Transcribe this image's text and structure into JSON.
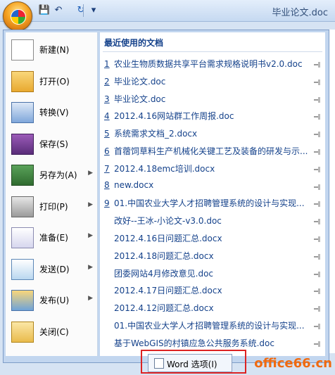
{
  "window": {
    "doc_title": "毕业论文.doc"
  },
  "quick_access": {
    "save": "💾",
    "undo": "↶",
    "redo": "↻",
    "customize": "▾"
  },
  "left_menu": [
    {
      "label": "新建(N)",
      "icon": "new-document-icon",
      "arrow": false
    },
    {
      "label": "打开(O)",
      "icon": "open-folder-icon",
      "arrow": false
    },
    {
      "label": "转换(V)",
      "icon": "convert-icon",
      "arrow": false
    },
    {
      "label": "保存(S)",
      "icon": "save-icon",
      "arrow": false
    },
    {
      "label": "另存为(A)",
      "icon": "save-as-icon",
      "arrow": true
    },
    {
      "label": "打印(P)",
      "icon": "print-icon",
      "arrow": true
    },
    {
      "label": "准备(E)",
      "icon": "prepare-icon",
      "arrow": true
    },
    {
      "label": "发送(D)",
      "icon": "send-icon",
      "arrow": true
    },
    {
      "label": "发布(U)",
      "icon": "publish-icon",
      "arrow": true
    },
    {
      "label": "关闭(C)",
      "icon": "close-folder-icon",
      "arrow": false
    }
  ],
  "recent": {
    "heading": "最近使用的文档",
    "items": [
      {
        "num": "1",
        "name": "农业生物质数据共享平台需求规格说明书v2.0.doc"
      },
      {
        "num": "2",
        "name": "毕业论文.doc"
      },
      {
        "num": "3",
        "name": "毕业论文.doc"
      },
      {
        "num": "4",
        "name": "2012.4.16网站群工作周报.doc"
      },
      {
        "num": "5",
        "name": "系统需求文档_2.docx"
      },
      {
        "num": "6",
        "name": "首蓿饲草料生产机械化关键工艺及装备的研发与示..."
      },
      {
        "num": "7",
        "name": "2012.4.18emc培训.docx"
      },
      {
        "num": "8",
        "name": "new.docx"
      },
      {
        "num": "9",
        "name": "01.中国农业大学人才招聘管理系统的设计与实现..."
      },
      {
        "num": "",
        "name": "改好--王冰-小论文-v3.0.doc"
      },
      {
        "num": "",
        "name": "2012.4.16日问题汇总.docx"
      },
      {
        "num": "",
        "name": "2012.4.18问题汇总.docx"
      },
      {
        "num": "",
        "name": "团委网站4月修改意见.doc"
      },
      {
        "num": "",
        "name": "2012.4.17日问题汇总.docx"
      },
      {
        "num": "",
        "name": "2012.4.12问题汇总.docx"
      },
      {
        "num": "",
        "name": "01.中国农业大学人才招聘管理系统的设计与实现..."
      },
      {
        "num": "",
        "name": "基于WebGIS的村镇应急公共服务系统.doc"
      }
    ]
  },
  "footer": {
    "word_options": "Word 选项(I)"
  },
  "watermark": "office66.cn"
}
